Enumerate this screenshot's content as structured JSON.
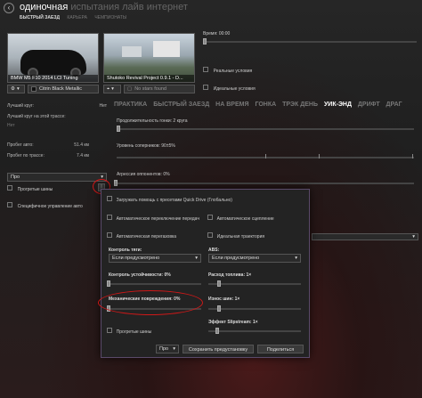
{
  "header": {
    "title_active": "одиночная",
    "title_rest": " испытания  лайв  интернет",
    "subnav": [
      "БЫСТРЫЙ ЗАЕЗД",
      "КАРЬЕРА",
      "ЧЕМПИОНАТЫ"
    ]
  },
  "car": {
    "name": "BMW M5 F10 2014 LCI Tuning",
    "skin": "Citrin Black Metallic"
  },
  "track": {
    "name": "Shutoko Revival Project 0.9.1 - D...",
    "layout": "No stars found"
  },
  "conditions": {
    "time_label": "Время: 00:00",
    "real_conditions": "Реальные условия",
    "ideal_conditions": "Идеальные условия"
  },
  "mode_tabs": [
    "ПРАКТИКА",
    "БЫСТРЫЙ ЗАЕЗД",
    "НА ВРЕМЯ",
    "ГОНКА",
    "ТРЭК ДЕНЬ",
    "УИК-ЭНД",
    "ДРИФТ",
    "ДРАГ"
  ],
  "mode_active_index": 5,
  "stats": {
    "best_lap_label": "Лучший круг:",
    "best_lap_track_label": "Лучший круг на этой трассе:",
    "best_lap_track_value": "Нет",
    "best_lap_value": "Нет",
    "car_mileage_label": "Пробег авто:",
    "car_mileage_value": "51.4 км",
    "track_mileage_label": "Пробег по трассе:",
    "track_mileage_value": "7.4 км"
  },
  "settings": {
    "practice_duration": "Продолжительность гонки: 2 круга",
    "opponent_level": "Уровень соперников: 90±5%",
    "opponent_aggression": "Агрессия оппонентов: 0%"
  },
  "assist": {
    "preset": "Про",
    "warm_tires": "Прогретые шины",
    "car_specific": "Специфичное управление авто"
  },
  "popup": {
    "load_preset": "Загружать помощь с пресетами Quick Drive (Глобально)",
    "auto_shift": "Автоматическое переключение передач",
    "auto_clutch": "Автоматическое сцепление",
    "auto_blip": "Автоматическая перегазовка",
    "ideal_line": "Идеальная траектория",
    "tc_label": "Контроль тяги:",
    "tc_value": "Если предусмотрено",
    "abs_label": "ABS:",
    "abs_value": "Если предусмотрено",
    "stability_label": "Контроль устойчивости: 0%",
    "fuel_label": "Расход топлива: 1×",
    "damage_label": "Механические повреждения: 0%",
    "tyre_wear_label": "Износ шин: 1×",
    "slipstream_label": "Эффект Slipstream: 1×",
    "warm_tires": "Прогретые шины",
    "preset": "Про",
    "save_preset": "Сохранить предустановку",
    "share": "Поделиться"
  },
  "colors": {
    "highlight": "#d01818",
    "popup_border": "#5a4a6a"
  }
}
